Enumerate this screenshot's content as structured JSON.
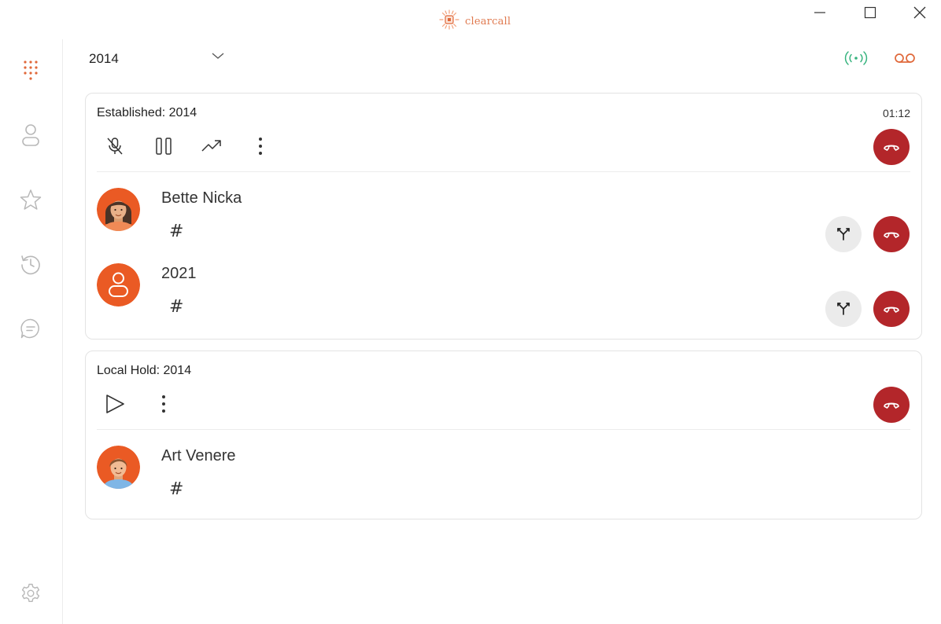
{
  "app": {
    "name": "clearcall",
    "brand_color": "#e0683a"
  },
  "window_controls": {
    "minimize_icon": "minimize-icon",
    "maximize_icon": "maximize-icon",
    "close_icon": "close-icon"
  },
  "sidebar": {
    "items": [
      {
        "name": "dialpad",
        "icon": "dialpad-icon",
        "active": true
      },
      {
        "name": "contacts",
        "icon": "person-icon",
        "active": false
      },
      {
        "name": "favorites",
        "icon": "star-icon",
        "active": false
      },
      {
        "name": "history",
        "icon": "history-icon",
        "active": false
      },
      {
        "name": "messages",
        "icon": "chat-icon",
        "active": false
      }
    ],
    "settings_icon": "gear-icon"
  },
  "line_selector": {
    "value": "2014"
  },
  "status": {
    "connection_icon": "signal-icon",
    "connection_color": "#36b37e",
    "voicemail_icon": "voicemail-icon",
    "voicemail_color": "#e0683a"
  },
  "calls": [
    {
      "title": "Established: 2014",
      "timer": "01:12",
      "controls": [
        "mute-icon",
        "pause-icon",
        "transfer-icon",
        "more-icon"
      ],
      "parties": [
        {
          "name": "Bette Nicka",
          "dtmf_label": "#",
          "avatar": "female-avatar"
        },
        {
          "name": "2021",
          "dtmf_label": "#",
          "avatar": "generic-avatar"
        }
      ]
    },
    {
      "title": "Local Hold: 2014",
      "timer": "",
      "controls": [
        "play-icon",
        "more-icon"
      ],
      "parties": [
        {
          "name": "Art Venere",
          "dtmf_label": "#",
          "avatar": "male-avatar"
        }
      ]
    }
  ],
  "colors": {
    "hangup": "#b3262a",
    "split_bg": "#ebebeb",
    "avatar_orange": "#ea5a24"
  }
}
